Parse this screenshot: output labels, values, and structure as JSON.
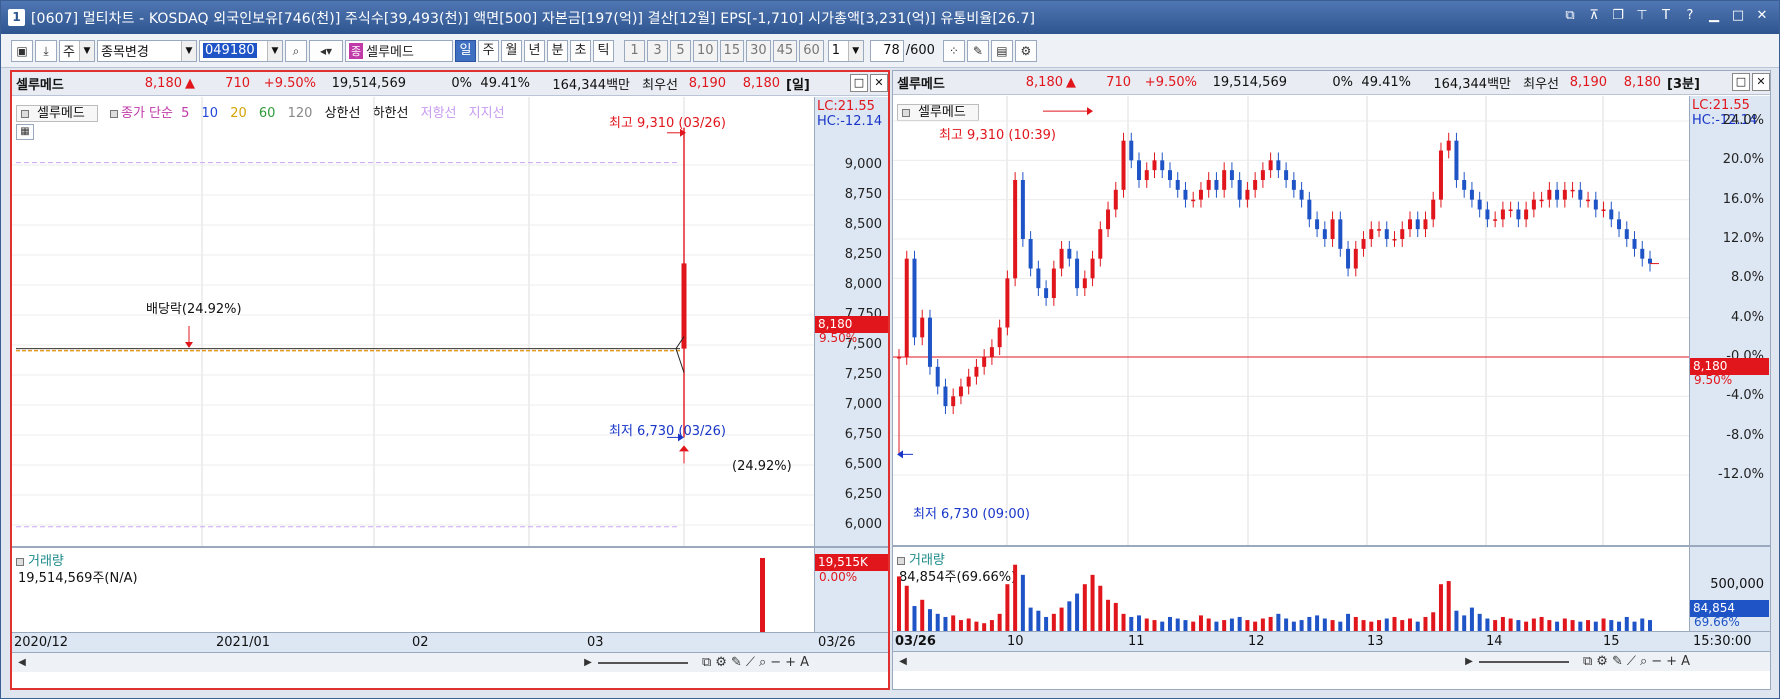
{
  "titlebar": {
    "number": "1",
    "title": "[0607] 멀티차트 - KOSDAQ 외국인보유[746(천)] 주식수[39,493(천)] 액면[500] 자본금[197(억)] 결산[12월] EPS[-1,710] 시가총액[3,231(억)] 유통비율[26.7]",
    "buttons": [
      "restore-icon",
      "pin-icon",
      "window-icon",
      "pin2-icon",
      "font-icon",
      "help-icon",
      "minimize-icon",
      "maximize-icon",
      "close-icon"
    ]
  },
  "toolbar": {
    "type_label": "주",
    "combo_label": "종목변경",
    "code_value": "049180",
    "stock_tag": "종",
    "stock_name": "셀루메드",
    "periods": [
      "일",
      "주",
      "월",
      "년",
      "분",
      "초",
      "틱"
    ],
    "active_period": "일",
    "intervals": [
      "1",
      "3",
      "5",
      "10",
      "15",
      "30",
      "45",
      "60"
    ],
    "n_value": "1",
    "count_value": "78",
    "count_total": "/600"
  },
  "left": {
    "info": {
      "name": "셀루메드",
      "price": "8,180",
      "arrow": "▲",
      "change": "710",
      "pct": "+9.50%",
      "volume": "19,514,569",
      "zero": "0%",
      "ratio": "49.41%",
      "amount": "164,344백만",
      "bid_label": "최우선",
      "bid1": "8,190",
      "bid2": "8,180",
      "period": "[일]"
    },
    "legend": {
      "name": "셀루메드",
      "ma_label": "종가 단순",
      "ma": [
        "5",
        "10",
        "20",
        "60",
        "120"
      ],
      "upper": "상한선",
      "lower": "하한선",
      "resist": "저항선",
      "support": "지지선"
    },
    "lc": "LC:21.55",
    "hc": "HC:-12.14",
    "yticks": [
      "9,000",
      "8,750",
      "8,500",
      "8,250",
      "8,000",
      "7,750",
      "7,500",
      "7,250",
      "7,000",
      "6,750",
      "6,500",
      "6,250",
      "6,000"
    ],
    "price_tag": "8,180",
    "pct_tag": "9.50%",
    "high_label": "최고 9,310 (03/26)",
    "low_label": "최저 6,730 (03/26)",
    "dividend_label": "배당락(24.92%)",
    "low_pct_label": "(24.92%)",
    "volume": {
      "title": "거래량",
      "value": "19,514,569주(N/A)",
      "tag": "19,515K",
      "tag2": "0.00%"
    },
    "xlabels": [
      "2020/12",
      "2021/01",
      "02",
      "03",
      "03/26"
    ]
  },
  "right": {
    "info": {
      "name": "셀루메드",
      "price": "8,180",
      "arrow": "▲",
      "change": "710",
      "pct": "+9.50%",
      "volume": "19,514,569",
      "zero": "0%",
      "ratio": "49.41%",
      "amount": "164,344백만",
      "bid_label": "최우선",
      "bid1": "8,190",
      "bid2": "8,180",
      "period": "[3분]"
    },
    "legend": {
      "name": "셀루메드"
    },
    "lc": "LC:21.55",
    "hc": "HC:-12.14",
    "yticks": [
      "24.0%",
      "20.0%",
      "16.0%",
      "12.0%",
      "8.0%",
      "4.0%",
      "-0.0%",
      "-4.0%",
      "-8.0%",
      "-12.0%"
    ],
    "price_tag": "8,180",
    "pct_tag": "9.50%",
    "high_label": "최고 9,310 (10:39)",
    "low_label": "최저 6,730 (09:00)",
    "volume": {
      "title": "거래량",
      "value": "84,854주(69.66%)",
      "ytick": "500,000",
      "tag": "84,854",
      "tag2": "69.66%"
    },
    "xlabels": [
      "03/26",
      "10",
      "11",
      "12",
      "13",
      "14",
      "15",
      "15:30:00"
    ]
  },
  "chart_data": [
    {
      "type": "candlestick",
      "title": "셀루메드 [일]",
      "x": [
        "03/26"
      ],
      "candles": [
        {
          "x": "03/26",
          "open": 7470,
          "high": 9310,
          "low": 6730,
          "close": 8180
        }
      ],
      "ylim": [
        5950,
        9350
      ],
      "volume": [
        19514569
      ]
    },
    {
      "type": "candlestick",
      "title": "셀루메드 [3분]",
      "ylabel_unit": "%",
      "ylim": [
        -12.5,
        24.5
      ],
      "x_sessions": [
        "09:00",
        "10",
        "11",
        "12",
        "13",
        "14",
        "15"
      ],
      "high": 24.6,
      "low": -9.9,
      "last": 9.5
    }
  ]
}
